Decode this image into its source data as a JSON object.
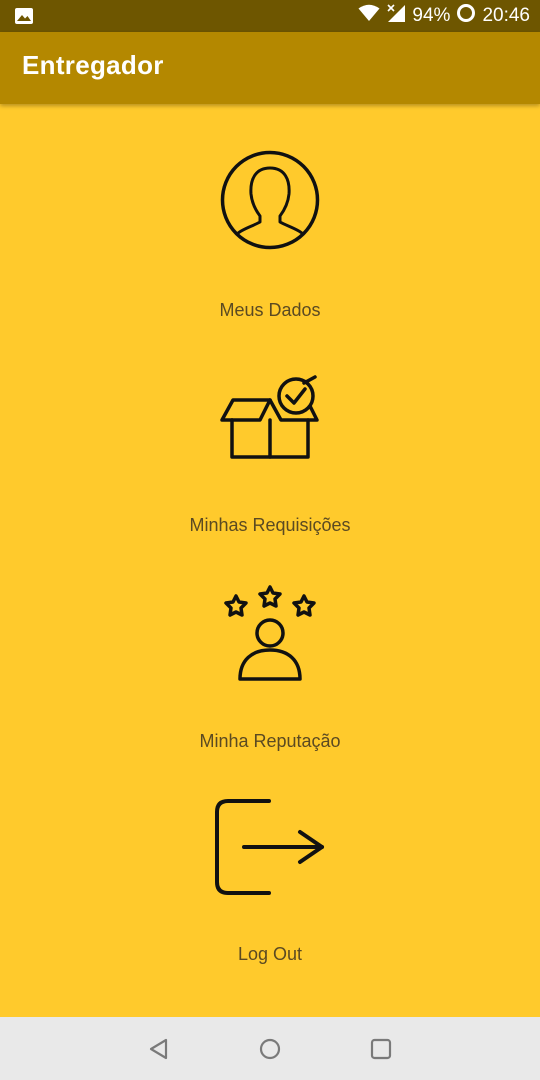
{
  "status_bar": {
    "battery": "94%",
    "time": "20:46",
    "icons": [
      "image-icon",
      "wifi-icon",
      "signal-icon",
      "battery-icon"
    ]
  },
  "app_bar": {
    "title": "Entregador"
  },
  "menu": {
    "items": [
      {
        "label": "Meus Dados",
        "icon": "user-profile-icon"
      },
      {
        "label": "Minhas Requisições",
        "icon": "box-check-icon"
      },
      {
        "label": "Minha Reputação",
        "icon": "user-stars-icon"
      },
      {
        "label": "Log Out",
        "icon": "logout-icon"
      }
    ]
  },
  "nav_bar": {
    "icons": [
      "back-icon",
      "home-icon",
      "recents-icon"
    ]
  },
  "colors": {
    "background": "#FFCA2C",
    "app_bar": "#B48800",
    "status_bar": "#6E5600",
    "label": "#5B4A22",
    "nav_bar": "#E9E9E9"
  }
}
